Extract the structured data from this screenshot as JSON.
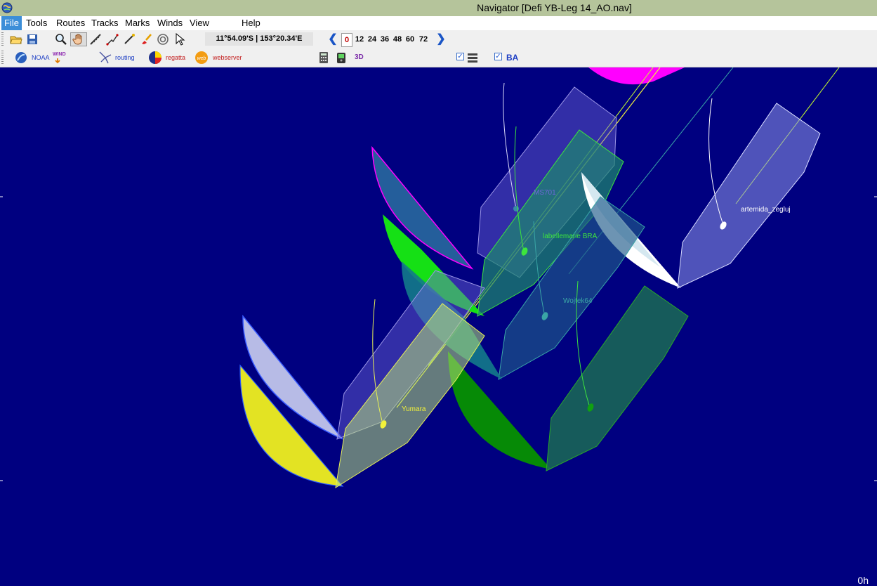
{
  "window": {
    "title": "Navigator [Defi YB-Leg 14_AO.nav]"
  },
  "menu": {
    "file": "File",
    "tools": "Tools",
    "routes": "Routes",
    "tracks": "Tracks",
    "marks": "Marks",
    "winds": "Winds",
    "view": "View",
    "help": "Help"
  },
  "toolbar": {
    "position": "11°54.09'S | 153°20.34'E",
    "hours": [
      "0",
      "12",
      "24",
      "36",
      "48",
      "60",
      "72"
    ],
    "selected_hour": "0",
    "noaa_label": "NOAA",
    "wind_label": "WIND",
    "routing_label": "routing",
    "regatta_label": "regatta",
    "webserver_label": "webserver",
    "label_3d": "3D",
    "ba_label": "BA"
  },
  "boats": [
    {
      "name": "artemida_zegluj",
      "color": "#ffffff"
    },
    {
      "name": "labellemarie BRA",
      "color": "#3de53d"
    },
    {
      "name": "Wojtek64",
      "color": "#3aa6a6"
    },
    {
      "name": "Yumara",
      "color": "#f2f23a"
    },
    {
      "name": "MS701",
      "color": "#6f67d8"
    }
  ],
  "map": {
    "time_label": "0h"
  },
  "colors": {
    "sea": "#000080",
    "titlebar": "#b5c49b"
  }
}
